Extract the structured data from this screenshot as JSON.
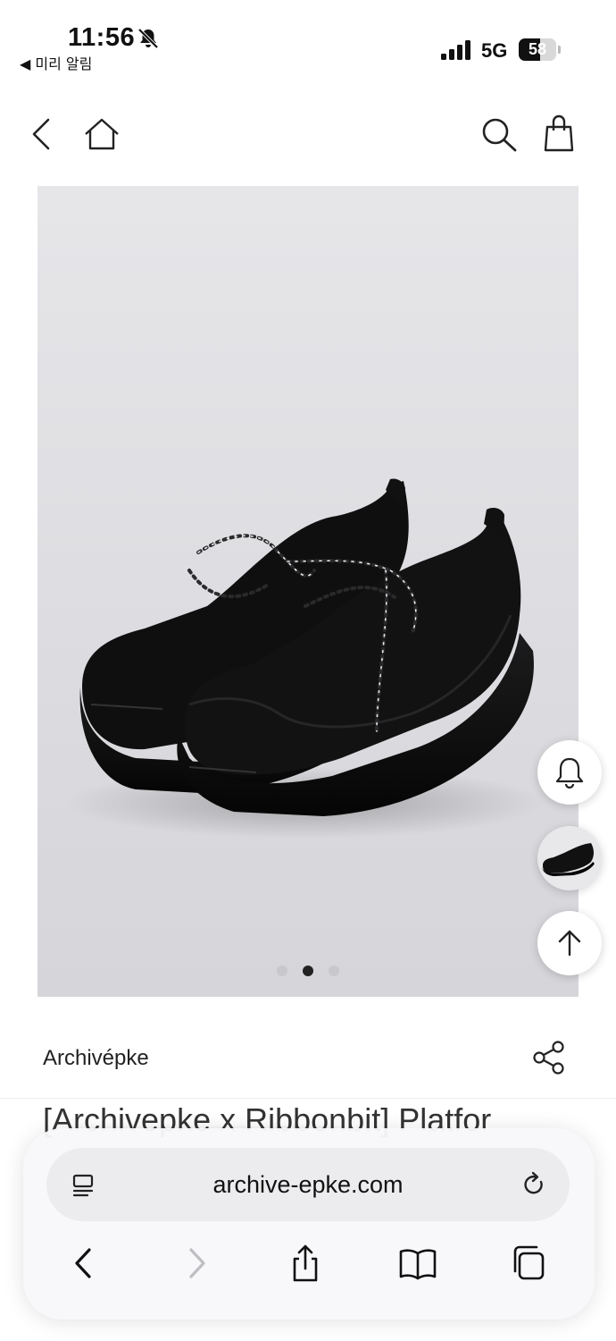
{
  "status_bar": {
    "time": "11:56",
    "back_app_label": "◀ 미리 알림",
    "network": "5G",
    "battery_percent": 58,
    "battery_label": "58"
  },
  "header": {
    "back_icon": "chevron-left-icon",
    "home_icon": "home-icon",
    "search_icon": "search-icon",
    "bag_icon": "shopping-bag-icon"
  },
  "gallery": {
    "slide_count": 3,
    "active_slide_index": 1
  },
  "floating_buttons": {
    "bell_icon": "bell-icon",
    "up_icon": "arrow-up-icon"
  },
  "product": {
    "brand": "Archivépke",
    "title_partial": "[Archivepke x Ribbonbit] Platfor"
  },
  "browser": {
    "url": "archive-epke.com"
  }
}
